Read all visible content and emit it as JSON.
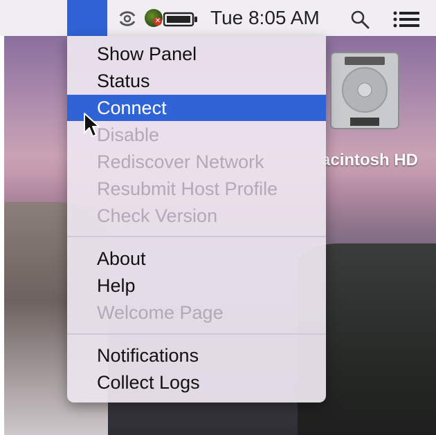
{
  "menubar": {
    "clock": "Tue 8:05 AM",
    "icons": [
      "app-status-icon",
      "sync-icon",
      "battery-icon",
      "search-icon",
      "list-icon"
    ]
  },
  "desktop": {
    "drive_label": "acintosh HD"
  },
  "menu": {
    "items": [
      {
        "label": "Show Panel",
        "enabled": true
      },
      {
        "label": "Status",
        "enabled": true
      },
      {
        "label": "Connect",
        "enabled": true,
        "highlighted": true
      },
      {
        "label": "Disable",
        "enabled": false
      },
      {
        "label": "Rediscover Network",
        "enabled": false
      },
      {
        "label": "Resubmit Host Profile",
        "enabled": false
      },
      {
        "label": "Check Version",
        "enabled": false
      },
      {
        "label": "About",
        "enabled": true
      },
      {
        "label": "Help",
        "enabled": true
      },
      {
        "label": "Welcome Page",
        "enabled": false
      },
      {
        "label": "Notifications",
        "enabled": true
      },
      {
        "label": "Collect Logs",
        "enabled": true
      }
    ]
  },
  "colors": {
    "highlight": "#2f63d6",
    "disabled_text": "#b3a9b6",
    "menubar_bg": "#f1eef3"
  }
}
